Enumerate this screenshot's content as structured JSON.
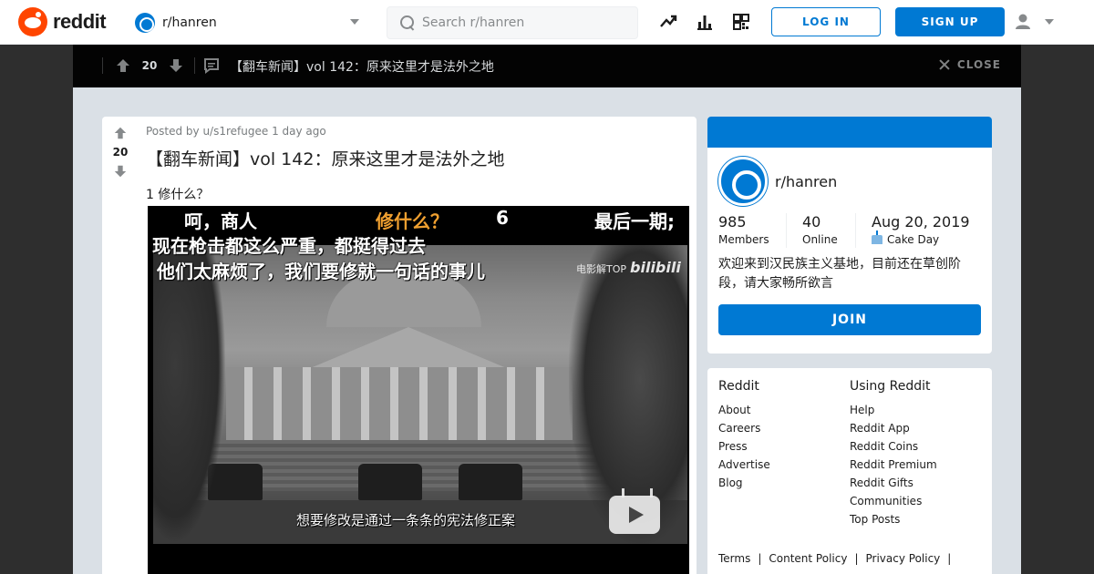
{
  "header": {
    "logo_text": "reddit",
    "community": "r/hanren",
    "search_placeholder": "Search r/hanren",
    "login_label": "LOG IN",
    "signup_label": "SIGN UP"
  },
  "post_bar": {
    "score": "20",
    "title": "【翻车新闻】vol 142：原来这里才是法外之地",
    "close_label": "CLOSE"
  },
  "post": {
    "score": "20",
    "posted_by": "Posted by u/s1refugee 1 day ago",
    "title": "【翻车新闻】vol 142：原来这里才是法外之地",
    "body": "1 修什么？"
  },
  "video": {
    "caption_line1_a": "呵，商人",
    "caption_line1_b": "修什么？",
    "caption_line1_c": "6",
    "caption_line1_d": "最后一期;",
    "caption_line2": "现在枪击都这么严重，都挺得过去",
    "caption_line3": "他们太麻烦了，我们要修就一句话的事儿",
    "subtitle": "想要修改是通过一条条的宪法修正案",
    "watermark_text": "电影解TOP",
    "watermark_brand": "bilibili"
  },
  "sidebar": {
    "community_name": "r/hanren",
    "members_value": "985",
    "members_label": "Members",
    "online_value": "40",
    "online_label": "Online",
    "cake_value": "Aug 20, 2019",
    "cake_label": "Cake Day",
    "description": "欢迎来到汉民族主义基地，目前还在草创阶段，请大家畅所欲言",
    "join_label": "JOIN"
  },
  "footer": {
    "col1_title": "Reddit",
    "col1_links": [
      "About",
      "Careers",
      "Press",
      "Advertise",
      "Blog"
    ],
    "col2_title": "Using Reddit",
    "col2_links": [
      "Help",
      "Reddit App",
      "Reddit Coins",
      "Reddit Premium",
      "Reddit Gifts",
      "Communities",
      "Top Posts"
    ],
    "legal_links": [
      "Terms",
      "Content Policy",
      "Privacy Policy"
    ]
  },
  "colors": {
    "brand": "#ff4500",
    "accent": "#0079d3",
    "overlay_bar": "#030303",
    "page_bg": "#dae0e6"
  },
  "icons": [
    "reddit-logo-icon",
    "community-icon",
    "search-icon",
    "trending-icon",
    "stats-icon",
    "qr-icon",
    "user-icon",
    "upvote-icon",
    "downvote-icon",
    "comment-icon",
    "close-icon",
    "cake-icon",
    "play-icon"
  ]
}
